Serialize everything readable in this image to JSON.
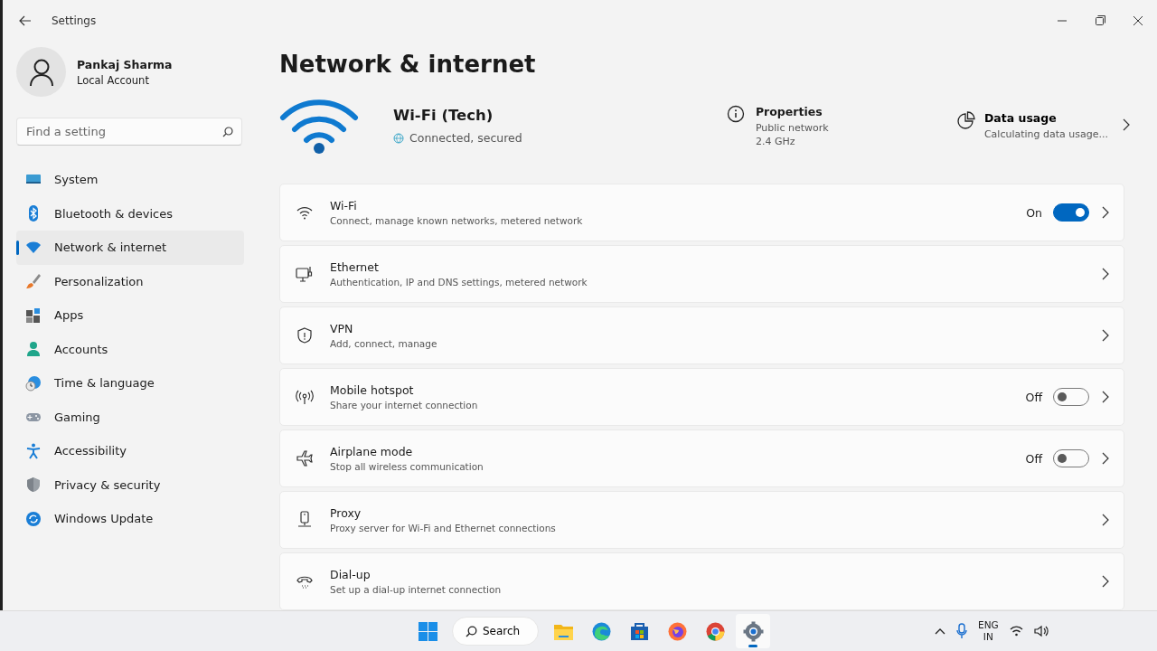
{
  "window": {
    "title": "Settings"
  },
  "profile": {
    "name": "Pankaj Sharma",
    "account": "Local Account"
  },
  "search": {
    "placeholder": "Find a setting"
  },
  "sidebar": {
    "items": [
      {
        "label": "System",
        "selected": false
      },
      {
        "label": "Bluetooth & devices",
        "selected": false
      },
      {
        "label": "Network & internet",
        "selected": true
      },
      {
        "label": "Personalization",
        "selected": false
      },
      {
        "label": "Apps",
        "selected": false
      },
      {
        "label": "Accounts",
        "selected": false
      },
      {
        "label": "Time & language",
        "selected": false
      },
      {
        "label": "Gaming",
        "selected": false
      },
      {
        "label": "Accessibility",
        "selected": false
      },
      {
        "label": "Privacy & security",
        "selected": false
      },
      {
        "label": "Windows Update",
        "selected": false
      }
    ]
  },
  "page": {
    "title": "Network & internet"
  },
  "connection": {
    "name": "Wi-Fi (Tech)",
    "status": "Connected, secured",
    "properties": {
      "title": "Properties",
      "lines": [
        "Public network",
        "2.4 GHz"
      ]
    },
    "data_usage": {
      "title": "Data usage",
      "detail": "Calculating data usage..."
    }
  },
  "settings": [
    {
      "kind": "toggle",
      "title": "Wi-Fi",
      "description": "Connect, manage known networks, metered network",
      "state_label": "On",
      "on": true
    },
    {
      "kind": "link",
      "title": "Ethernet",
      "description": "Authentication, IP and DNS settings, metered network"
    },
    {
      "kind": "link",
      "title": "VPN",
      "description": "Add, connect, manage"
    },
    {
      "kind": "toggle",
      "title": "Mobile hotspot",
      "description": "Share your internet connection",
      "state_label": "Off",
      "on": false
    },
    {
      "kind": "toggle",
      "title": "Airplane mode",
      "description": "Stop all wireless communication",
      "state_label": "Off",
      "on": false
    },
    {
      "kind": "link",
      "title": "Proxy",
      "description": "Proxy server for Wi-Fi and Ethernet connections"
    },
    {
      "kind": "link",
      "title": "Dial-up",
      "description": "Set up a dial-up internet connection"
    }
  ],
  "taskbar": {
    "search_label": "Search",
    "apps": [
      {
        "selected": false
      },
      {
        "selected": false
      },
      {
        "selected": false
      },
      {
        "selected": false
      },
      {
        "selected": false
      },
      {
        "selected": true
      }
    ],
    "language": {
      "line1": "ENG",
      "line2": "IN"
    }
  }
}
